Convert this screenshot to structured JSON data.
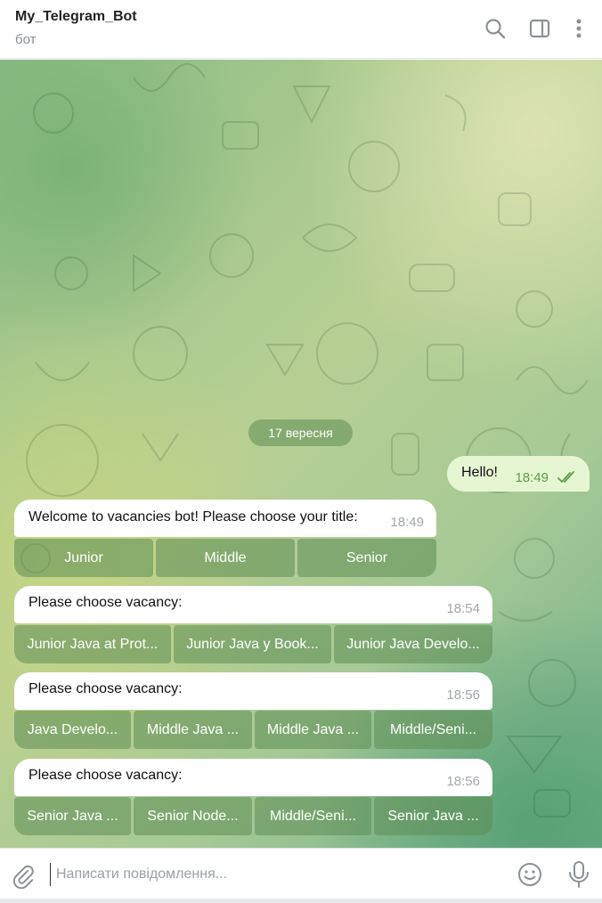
{
  "header": {
    "title": "My_Telegram_Bot",
    "subtitle": "бот",
    "icons": [
      "search-icon",
      "sidebar-toggle-icon",
      "more-vert-icon"
    ]
  },
  "chat": {
    "date_label": "17 вересня",
    "outgoing": {
      "text": "Hello!",
      "time": "18:49",
      "status": "read"
    },
    "messages": [
      {
        "text": "Welcome to vacancies bot! Please choose your title:",
        "time": "18:49",
        "buttons": [
          "Junior",
          "Middle",
          "Senior"
        ]
      },
      {
        "text": "Please choose vacancy:",
        "time": "18:54",
        "buttons": [
          "Junior Java at Prot...",
          "Junior Java у Book...",
          "Junior Java Develo..."
        ]
      },
      {
        "text": "Please choose vacancy:",
        "time": "18:56",
        "buttons": [
          "Java Develo...",
          "Middle Java ...",
          "Middle Java ...",
          "Middle/Seni..."
        ]
      },
      {
        "text": "Please choose vacancy:",
        "time": "18:56",
        "buttons": [
          "Senior Java ...",
          "Senior Node...",
          "Middle/Seni...",
          "Senior Java ..."
        ]
      }
    ]
  },
  "composer": {
    "placeholder": "Написати повідомлення..."
  },
  "colors": {
    "outgoing_bubble": "#e6f6d3",
    "outgoing_time": "#5c9d47",
    "keyboard_button": "#5c8c54"
  }
}
